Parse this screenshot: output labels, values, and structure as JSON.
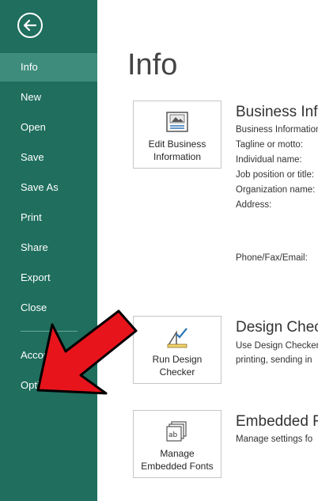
{
  "sidebar": {
    "back_icon": "back-arrow-icon",
    "items": [
      {
        "label": "Info",
        "active": true
      },
      {
        "label": "New"
      },
      {
        "label": "Open"
      },
      {
        "label": "Save"
      },
      {
        "label": "Save As"
      },
      {
        "label": "Print"
      },
      {
        "label": "Share"
      },
      {
        "label": "Export"
      },
      {
        "label": "Close"
      },
      {
        "label": "Account"
      },
      {
        "label": "Options"
      }
    ]
  },
  "main": {
    "title": "Info",
    "business": {
      "tile_line1": "Edit Business",
      "tile_line2": "Information",
      "heading": "Business Info",
      "fields": [
        "Business Information",
        "Tagline or motto:",
        "Individual name:",
        "Job position or title:",
        "Organization name:",
        "Address:",
        "Phone/Fax/Email:"
      ]
    },
    "design": {
      "tile_line1": "Run Design",
      "tile_line2": "Checker",
      "heading": "Design Check",
      "lines": [
        "Use Design Checker",
        "printing, sending in"
      ]
    },
    "fonts": {
      "tile_line1": "Manage",
      "tile_line2": "Embedded Fonts",
      "heading": "Embedded F",
      "lines": [
        "Manage settings fo"
      ]
    }
  },
  "annotation": {
    "arrow_color": "#e8141c",
    "target": "Options"
  },
  "colors": {
    "sidebar": "#1f6e5e",
    "active": "#3e8c7b"
  }
}
